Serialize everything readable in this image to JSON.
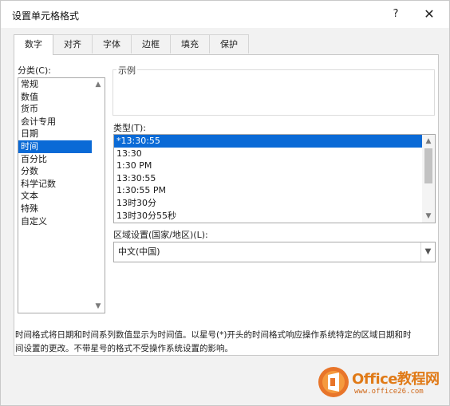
{
  "window": {
    "title": "设置单元格格式",
    "help_glyph": "?",
    "close_glyph": "✕"
  },
  "tabs": [
    {
      "label": "数字",
      "active": true
    },
    {
      "label": "对齐",
      "active": false
    },
    {
      "label": "字体",
      "active": false
    },
    {
      "label": "边框",
      "active": false
    },
    {
      "label": "填充",
      "active": false
    },
    {
      "label": "保护",
      "active": false
    }
  ],
  "category": {
    "label": "分类(C):",
    "items": [
      "常规",
      "数值",
      "货币",
      "会计专用",
      "日期",
      "时间",
      "百分比",
      "分数",
      "科学记数",
      "文本",
      "特殊",
      "自定义"
    ],
    "selected": "时间"
  },
  "sample": {
    "legend": "示例",
    "value": ""
  },
  "type": {
    "label": "类型(T):",
    "items": [
      "*13:30:55",
      "13:30",
      "1:30 PM",
      "13:30:55",
      "1:30:55 PM",
      "13时30分",
      "13时30分55秒"
    ],
    "selected": "*13:30:55"
  },
  "locale": {
    "label": "区域设置(国家/地区)(L):",
    "value": "中文(中国)"
  },
  "description": {
    "line1": "时间格式将日期和时间系列数值显示为时间值。以星号(*)开头的时间格式响应操作系统特定的区域日期和时",
    "line2": "间设置的更改。不带星号的格式不受操作系统设置的影响。"
  },
  "watermark": {
    "title": "Office教程网",
    "url": "www.office26.com"
  },
  "colors": {
    "selection": "#0a6ad6",
    "watermark_orange": "#e07a17"
  },
  "icons": {
    "scroll_up": "chevron-up-icon",
    "scroll_down": "chevron-down-icon",
    "dropdown": "chevron-down-icon",
    "logo": "office-logo-icon"
  }
}
